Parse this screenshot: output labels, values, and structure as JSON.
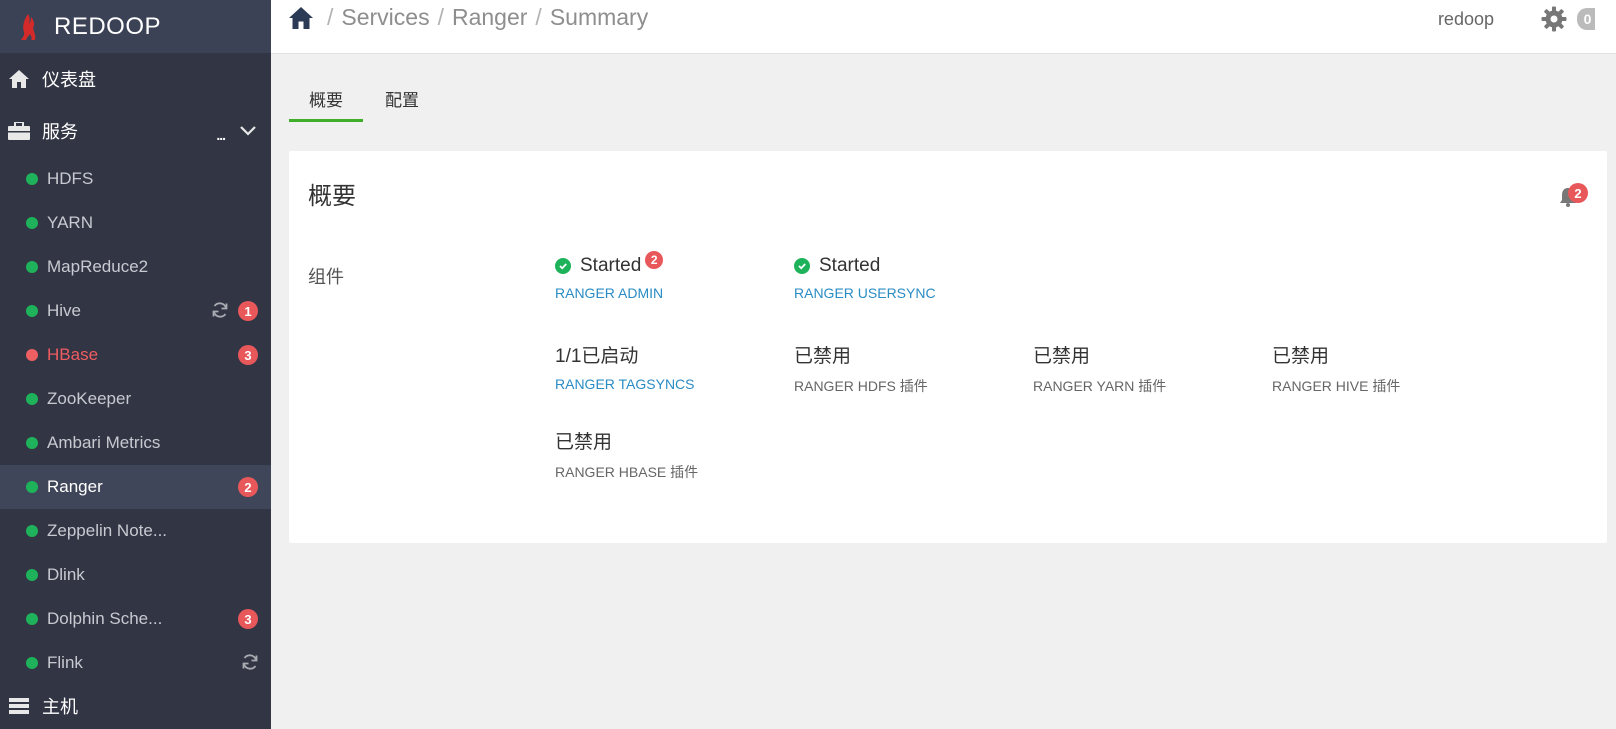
{
  "brand": {
    "name": "REDOOP"
  },
  "nav": {
    "dashboard": {
      "label": "仪表盘"
    },
    "services": {
      "label": "服务",
      "more": "..."
    },
    "hosts": {
      "label": "主机"
    }
  },
  "services": [
    {
      "name": "HDFS",
      "status": "ok"
    },
    {
      "name": "YARN",
      "status": "ok"
    },
    {
      "name": "MapReduce2",
      "status": "ok"
    },
    {
      "name": "Hive",
      "status": "ok",
      "badge": "1",
      "refresh": true
    },
    {
      "name": "HBase",
      "status": "alert",
      "badge": "3"
    },
    {
      "name": "ZooKeeper",
      "status": "ok"
    },
    {
      "name": "Ambari Metrics",
      "status": "ok"
    },
    {
      "name": "Ranger",
      "status": "ok",
      "badge": "2",
      "active": true
    },
    {
      "name": "Zeppelin Note...",
      "status": "ok"
    },
    {
      "name": "Dlink",
      "status": "ok"
    },
    {
      "name": "Dolphin Sche...",
      "status": "ok",
      "badge": "3"
    },
    {
      "name": "Flink",
      "status": "ok",
      "refresh": true
    }
  ],
  "breadcrumb": [
    "Services",
    "Ranger",
    "Summary"
  ],
  "header": {
    "user": "redoop",
    "ops_count": "0"
  },
  "tabs": [
    {
      "label": "概要",
      "active": true
    },
    {
      "label": "配置",
      "active": false
    }
  ],
  "summary": {
    "title": "概要",
    "alerts_count": "2",
    "components_label": "组件",
    "components": [
      {
        "status": "Started",
        "name": "RANGER ADMIN",
        "ok_icon": true,
        "badge": "2",
        "link": true
      },
      {
        "status": "Started",
        "name": "RANGER USERSYNC",
        "ok_icon": true,
        "link": true
      },
      {
        "status": "1/1已启动",
        "name": "RANGER TAGSYNCS",
        "link": true
      },
      {
        "status": "已禁用",
        "name": "RANGER HDFS 插件",
        "link": false
      },
      {
        "status": "已禁用",
        "name": "RANGER YARN 插件",
        "link": false
      },
      {
        "status": "已禁用",
        "name": "RANGER HIVE 插件",
        "link": false
      },
      {
        "status": "已禁用",
        "name": "RANGER HBASE 插件",
        "link": false
      }
    ]
  },
  "colors": {
    "sidebar": "#323544",
    "ok": "#1eb35a",
    "alert": "#e8585b",
    "link": "#2a8cc4",
    "tab_active": "#3fae2a"
  }
}
